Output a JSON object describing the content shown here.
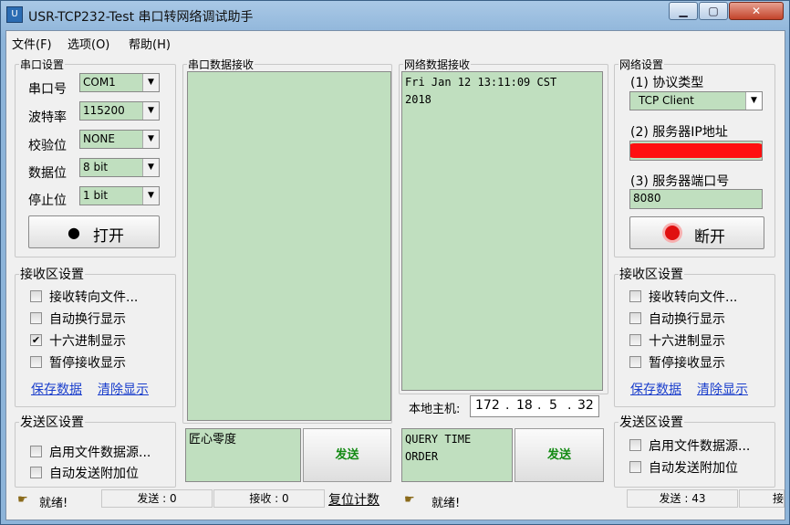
{
  "window": {
    "title": "USR-TCP232-Test 串口转网络调试助手",
    "icon": "app-icon",
    "min": "▁",
    "max": "▢",
    "close": "✕"
  },
  "menu": [
    "文件(F)",
    "选项(O)",
    "帮助(H)"
  ],
  "serial": {
    "legend": "串口设置",
    "port_label": "串口号",
    "port": "COM1",
    "baud_label": "波特率",
    "baud": "115200",
    "parity_label": "校验位",
    "parity": "NONE",
    "data_label": "数据位",
    "data": "8 bit",
    "stop_label": "停止位",
    "stop": "1 bit",
    "open": "打开",
    "open_icon": "●"
  },
  "left_recv": {
    "legend": "接收区设置",
    "items": [
      {
        "label": "接收转向文件...",
        "checked": false
      },
      {
        "label": "自动换行显示",
        "checked": false
      },
      {
        "label": "十六进制显示",
        "checked": true
      },
      {
        "label": "暂停接收显示",
        "checked": false
      }
    ],
    "save": "保存数据",
    "clear": "清除显示"
  },
  "left_send": {
    "legend": "发送区设置",
    "items": [
      {
        "label": "启用文件数据源...",
        "checked": false
      },
      {
        "label": "自动发送附加位",
        "checked": false
      }
    ]
  },
  "serial_recv": {
    "legend": "串口数据接收",
    "text": ""
  },
  "serial_send": {
    "text": "匠心零度",
    "button": "发送"
  },
  "net_recv": {
    "legend": "网络数据接收",
    "text": "Fri Jan 12 13:11:09 CST\n2018"
  },
  "local_host": {
    "label": "本地主机:",
    "ip": [
      "172",
      "18",
      "5",
      "32"
    ]
  },
  "net_send": {
    "text": "QUERY TIME\nORDER",
    "button": "发送"
  },
  "net": {
    "legend": "网络设置",
    "proto_label": "(1) 协议类型",
    "proto": "TCP Client",
    "ip_label": "(2) 服务器IP地址",
    "port_label": "(3) 服务器端口号",
    "port": "8080",
    "disconnect": "断开"
  },
  "right_recv": {
    "legend": "接收区设置",
    "items": [
      {
        "label": "接收转向文件...",
        "checked": false
      },
      {
        "label": "自动换行显示",
        "checked": false
      },
      {
        "label": "十六进制显示",
        "checked": false
      },
      {
        "label": "暂停接收显示",
        "checked": false
      }
    ],
    "save": "保存数据",
    "clear": "清除显示"
  },
  "right_send": {
    "legend": "发送区设置",
    "items": [
      {
        "label": "启用文件数据源...",
        "checked": false
      },
      {
        "label": "自动发送附加位",
        "checked": false
      }
    ]
  },
  "status_left": {
    "ready": "就绪!",
    "sent": "发送 : 0",
    "recv": "接收 : 0",
    "reset": "复位计数"
  },
  "status_right": {
    "ready": "就绪!",
    "sent": "发送 : 43",
    "recv": "接"
  },
  "colors": {
    "field": "#c0dfbf",
    "link": "#1a3ecc",
    "send": "#138a13",
    "record": "#e01010"
  }
}
